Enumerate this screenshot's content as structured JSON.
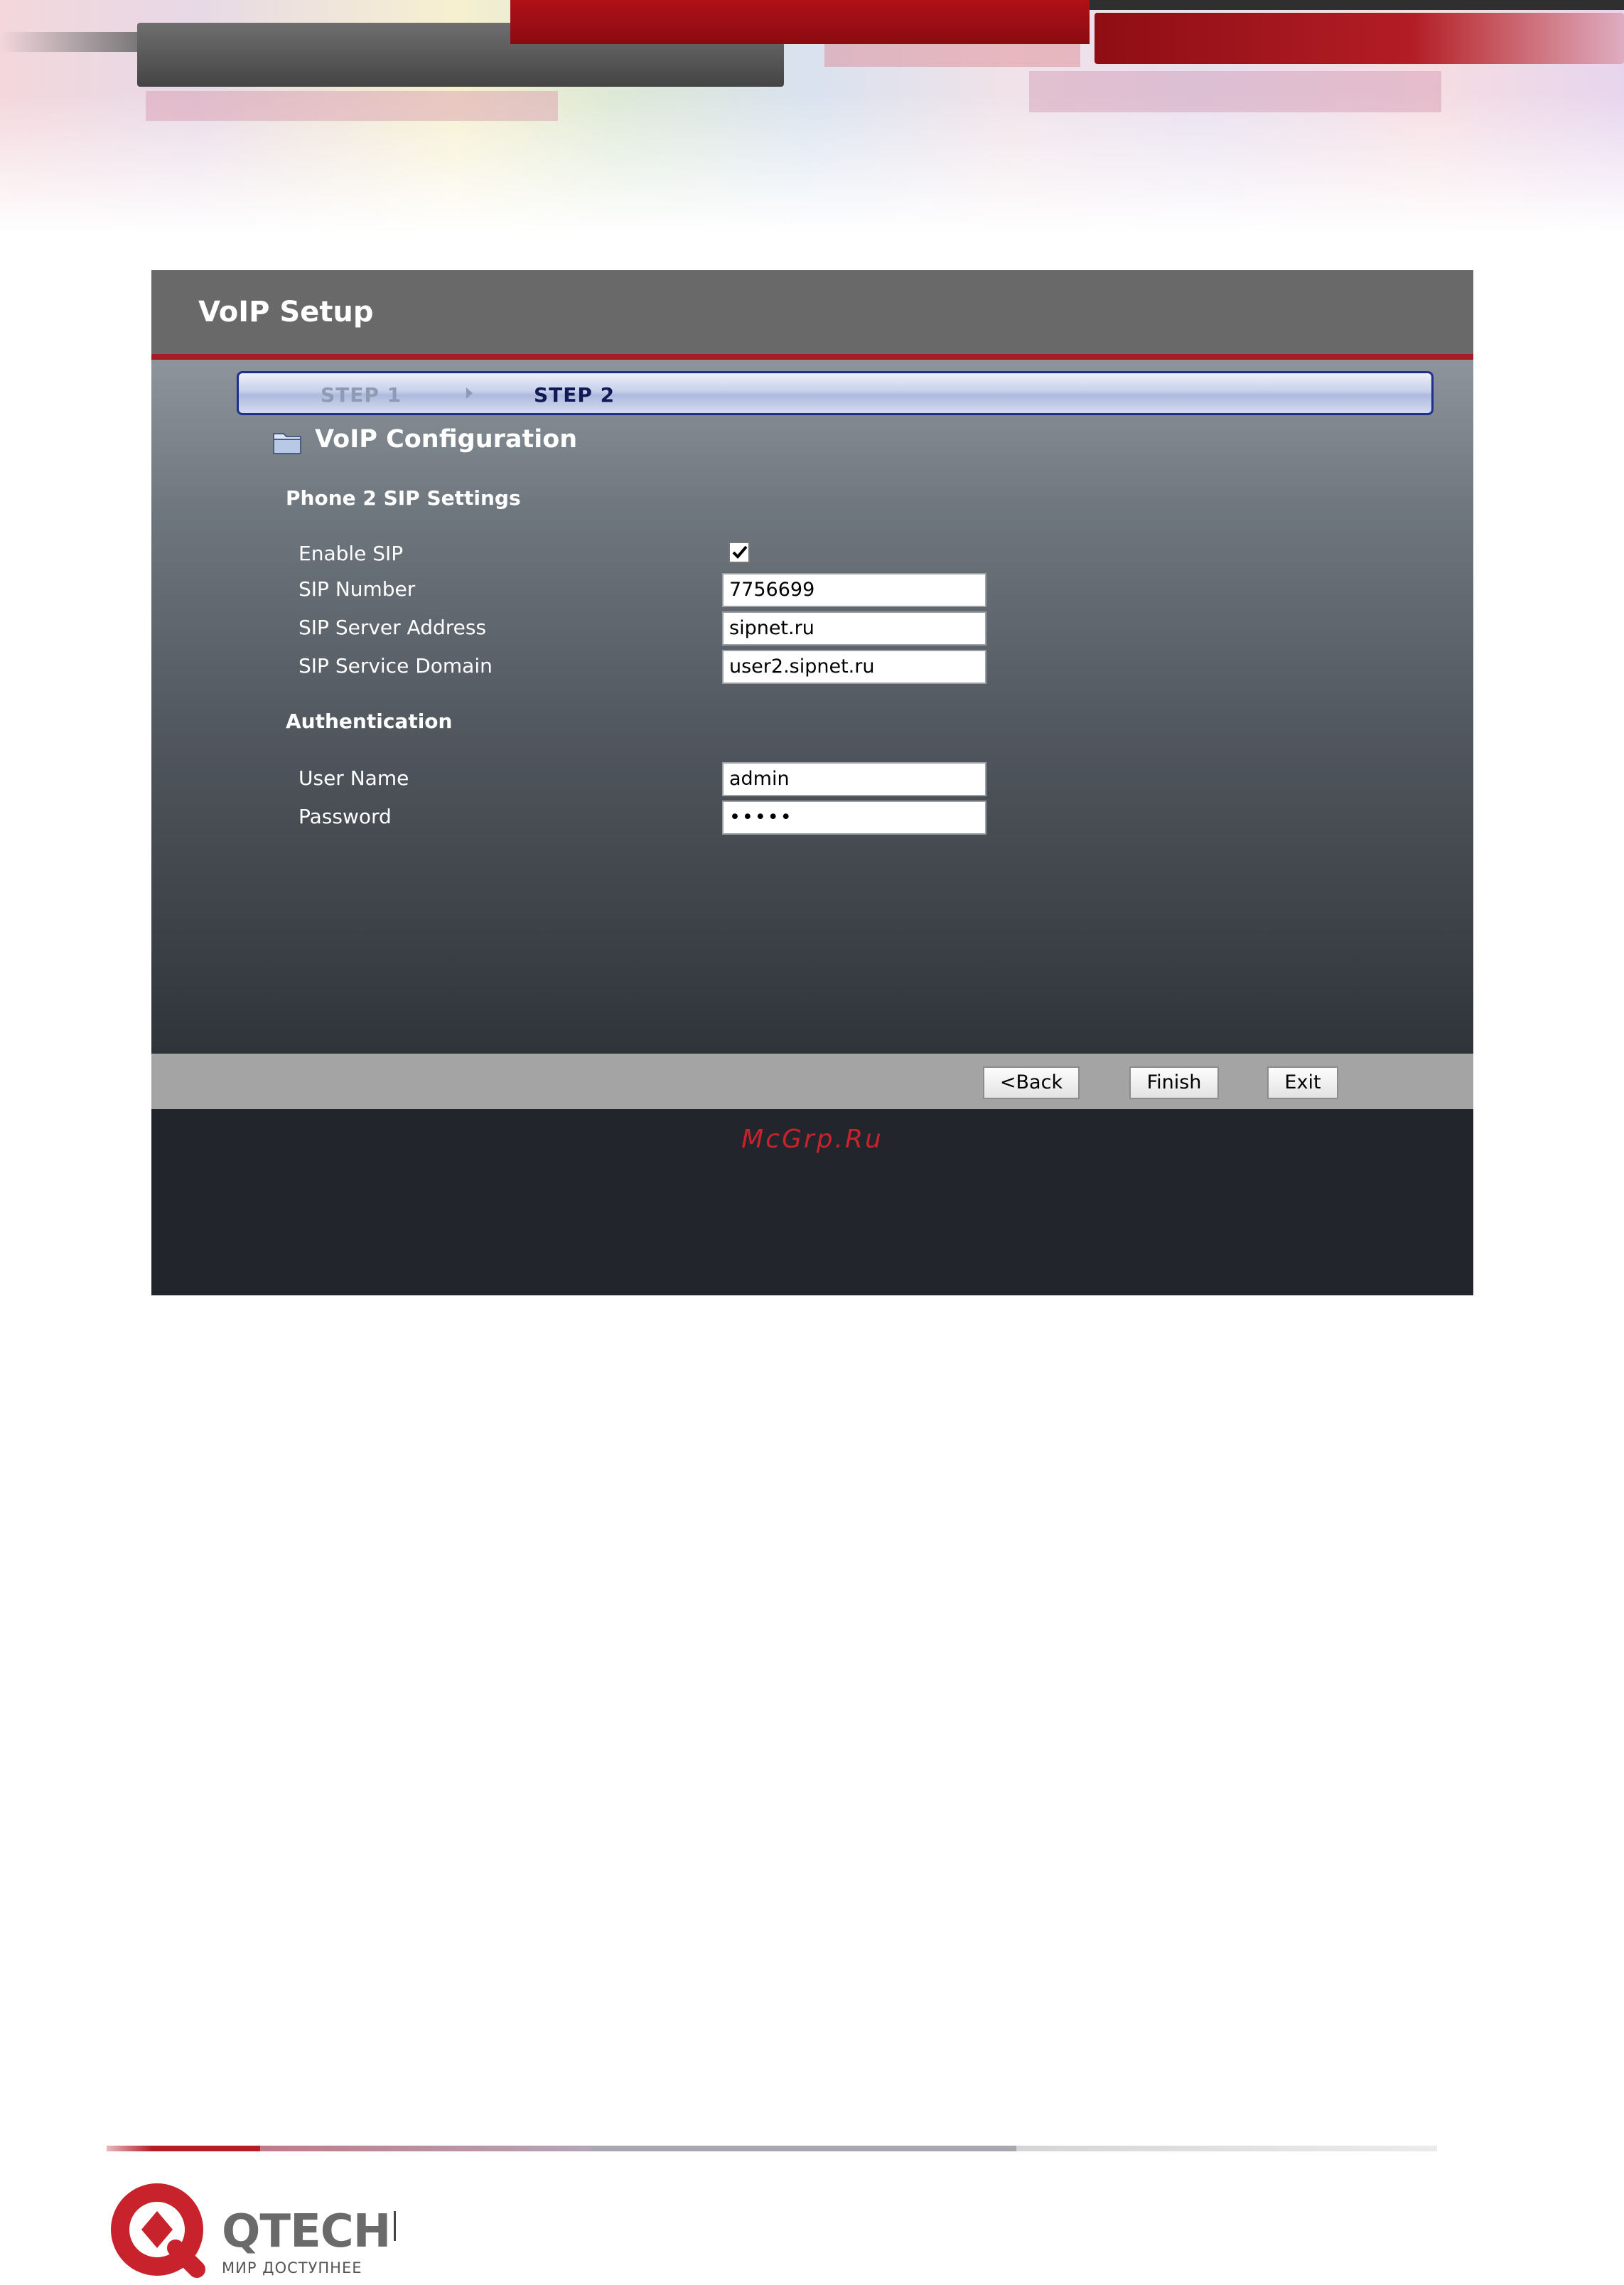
{
  "window": {
    "title": "VoIP Setup"
  },
  "steps": {
    "step1": "STEP 1",
    "step2": "STEP 2"
  },
  "section": {
    "title": "VoIP Configuration"
  },
  "sip_settings": {
    "title": "Phone 2 SIP Settings",
    "enable_sip_label": "Enable SIP",
    "enable_sip_checked": true,
    "sip_number_label": "SIP Number",
    "sip_number_value": "7756699",
    "sip_server_label": "SIP Server Address",
    "sip_server_value": "sipnet.ru",
    "sip_domain_label": "SIP Service Domain",
    "sip_domain_value": "user2.sipnet.ru"
  },
  "authentication": {
    "title": "Authentication",
    "username_label": "User Name",
    "username_value": "admin",
    "password_label": "Password",
    "password_value": "•••••"
  },
  "buttons": {
    "back": "<Back",
    "finish": "Finish",
    "exit": "Exit"
  },
  "watermark": "McGrp.Ru",
  "brand": {
    "name": "QTECH",
    "tagline": "МИР ДОСТУПНЕЕ"
  },
  "colors": {
    "accent_red": "#a71b25",
    "step_border": "#1f2f8a",
    "brand_red": "#c8222c"
  }
}
